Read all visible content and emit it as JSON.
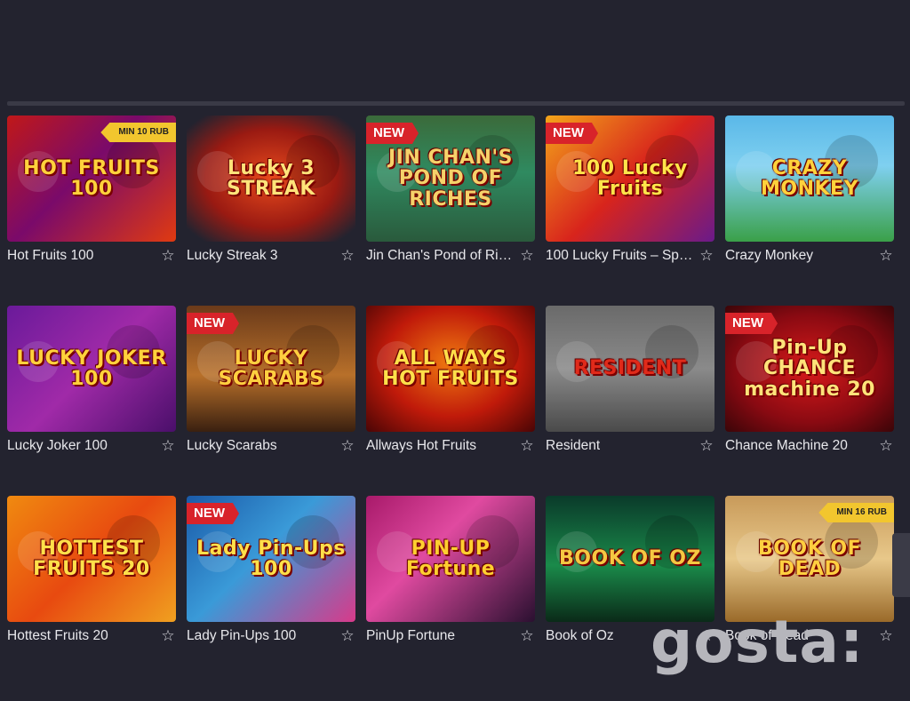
{
  "games": [
    {
      "name": "Hot Fruits 100",
      "art": "HOT FRUITS 100",
      "badge": "MIN 10 RUB",
      "badge_type": "min",
      "bg": "linear-gradient(135deg,#c01818 0%,#7a0a6a 45%,#e03a10 100%)",
      "color": "#ffd23c"
    },
    {
      "name": "Lucky Streak 3",
      "art": "Lucky 3 STREAK",
      "badge": "",
      "badge_type": "",
      "bg": "radial-gradient(ellipse at 50% 50%,#e84a1c 0%,#9a1a12 55%,#23232f 90%)",
      "color": "#ffe37a"
    },
    {
      "name": "Jin Chan's Pond of Ric…",
      "art": "JIN CHAN'S POND OF RICHES",
      "badge": "NEW",
      "badge_type": "new",
      "bg": "linear-gradient(180deg,#3b6a3a 0%,#2f8a60 45%,#2a5a3c 100%)",
      "color": "#f5d26a"
    },
    {
      "name": "100 Lucky Fruits – Spi…",
      "art": "100 Lucky Fruits",
      "badge": "NEW",
      "badge_type": "new",
      "bg": "linear-gradient(135deg,#f3a51a 0%,#d8241c 50%,#6a1a8a 100%)",
      "color": "#ffe54a"
    },
    {
      "name": "Crazy Monkey",
      "art": "CRAZY MONKEY",
      "badge": "",
      "badge_type": "",
      "bg": "linear-gradient(180deg,#5ab8e8 0%,#7fd0f0 40%,#3aa048 100%)",
      "color": "#ffd23c"
    },
    {
      "name": "Lucky Joker 100",
      "art": "LUCKY JOKER 100",
      "badge": "",
      "badge_type": "",
      "bg": "linear-gradient(135deg,#6a1a9a 0%,#a02aa8 50%,#4a0f6a 100%)",
      "color": "#ffd23c"
    },
    {
      "name": "Lucky Scarabs",
      "art": "LUCKY SCARABS",
      "badge": "NEW",
      "badge_type": "new",
      "bg": "linear-gradient(180deg,#6a3a1a 0%,#b8702a 55%,#3a2010 100%)",
      "color": "#ffcf40"
    },
    {
      "name": "Allways Hot Fruits",
      "art": "ALL WAYS HOT FRUITS",
      "badge": "",
      "badge_type": "",
      "bg": "radial-gradient(ellipse at 50% 45%,#f07a10 0%,#c01a0a 55%,#4a0505 100%)",
      "color": "#ffe04a"
    },
    {
      "name": "Resident",
      "art": "RESIDENT",
      "badge": "",
      "badge_type": "",
      "bg": "linear-gradient(180deg,#6a6a6a 0%,#8a8a8a 50%,#4a4a4a 100%)",
      "color": "#e02a1a"
    },
    {
      "name": "Chance Machine 20",
      "art": "Pin-Up CHANCE machine 20",
      "badge": "NEW",
      "badge_type": "new",
      "bg": "radial-gradient(ellipse at 50% 50%,#d81a1a 0%,#8a0a12 60%,#3a0508 100%)",
      "color": "#ffe37a"
    },
    {
      "name": "Hottest Fruits 20",
      "art": "HOTTEST FRUITS 20",
      "badge": "",
      "badge_type": "",
      "bg": "linear-gradient(135deg,#f08a10 0%,#e84a10 50%,#f0a020 100%)",
      "color": "#ffe04a"
    },
    {
      "name": "Lady Pin-Ups 100",
      "art": "Lady Pin-Ups 100",
      "badge": "NEW",
      "badge_type": "new",
      "bg": "linear-gradient(135deg,#1a5aa8 0%,#3a9ad8 45%,#d83a8a 100%)",
      "color": "#ffe04a"
    },
    {
      "name": "PinUp Fortune",
      "art": "PIN-UP Fortune",
      "badge": "",
      "badge_type": "",
      "bg": "linear-gradient(135deg,#a81a6a 0%,#e04aa0 40%,#2a1030 100%)",
      "color": "#ffcf30"
    },
    {
      "name": "Book of Oz",
      "art": "BOOK OF OZ",
      "badge": "",
      "badge_type": "",
      "bg": "linear-gradient(180deg,#0a3a2a 0%,#1a8a4a 55%,#0a2a18 100%)",
      "color": "#f5c842"
    },
    {
      "name": "Book of Dead",
      "art": "BOOK OF DEAD",
      "badge": "MIN 16 RUB",
      "badge_type": "min",
      "bg": "linear-gradient(180deg,#c89a5a 0%,#e8c88a 50%,#9a6a2a 100%)",
      "color": "#ffcf40"
    }
  ],
  "watermark": "gosta:",
  "favorite_icon": "star-outline-icon"
}
